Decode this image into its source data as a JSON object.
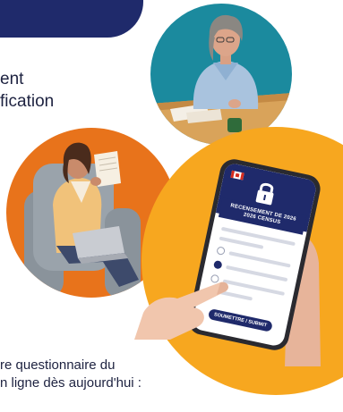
{
  "header": {
    "band_color": "#1f2a6b"
  },
  "text_fragments": {
    "line1": "ent",
    "line2": "fication",
    "line3": "re questionnaire du",
    "line4": "n ligne dès aujourd'hui :"
  },
  "illustrations": {
    "top_circle_color": "#1b8a9e",
    "left_circle_color": "#e8731b",
    "right_circle_color": "#f7a71f"
  },
  "phone_screen": {
    "title_line1": "RECENSEMENT DE 2026",
    "title_line2": "2026 CENSUS",
    "submit_label": "SOUMETTRE / SUBMIT",
    "icon": "lock-icon"
  }
}
